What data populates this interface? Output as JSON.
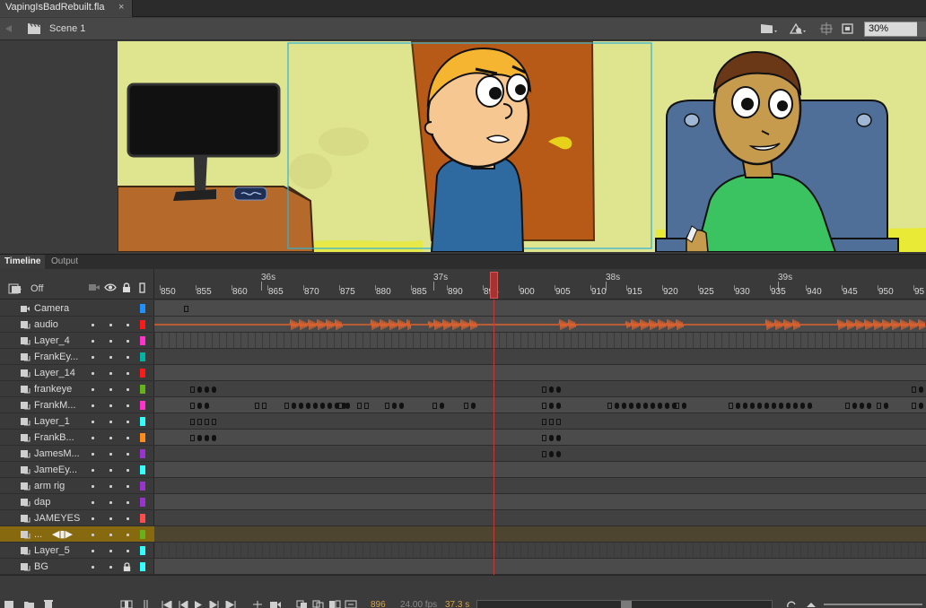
{
  "document": {
    "tab_title": "VapingIsBadRebuilt.fla",
    "close_glyph": "×"
  },
  "edit_bar": {
    "scene_label": "Scene 1",
    "zoom": "30%"
  },
  "panel_tabs": [
    {
      "label": "Timeline",
      "active": true
    },
    {
      "label": "Output",
      "active": false
    }
  ],
  "timeline": {
    "onion_label": "Off",
    "seconds": [
      "36s",
      "37s",
      "38s",
      "39s"
    ],
    "frame_ticks": [
      "850",
      "855",
      "860",
      "865",
      "870",
      "875",
      "880",
      "885",
      "890",
      "895",
      "900",
      "905",
      "910",
      "915",
      "920",
      "925",
      "930",
      "935",
      "940",
      "945",
      "950",
      "95"
    ],
    "current_frame": "896",
    "fps": "24.00 fps",
    "time": "37.3 s",
    "layers": [
      {
        "name": "Camera",
        "color": "#1e90ff",
        "type": "camera"
      },
      {
        "name": "audio",
        "color": "#ff1a1a"
      },
      {
        "name": "Layer_4",
        "color": "#ff33cc"
      },
      {
        "name": "FrankEy...",
        "color": "#00b3a4"
      },
      {
        "name": "Layer_14",
        "color": "#ff1a1a"
      },
      {
        "name": "frankeye",
        "color": "#66b219"
      },
      {
        "name": "FrankM...",
        "color": "#ff33cc"
      },
      {
        "name": "Layer_1",
        "color": "#33ffff"
      },
      {
        "name": "FrankB...",
        "color": "#ff8c1a"
      },
      {
        "name": "JamesM...",
        "color": "#9933cc"
      },
      {
        "name": "JameEy...",
        "color": "#33ffff"
      },
      {
        "name": "arm rig",
        "color": "#9933cc"
      },
      {
        "name": "dap",
        "color": "#9933cc"
      },
      {
        "name": "JAMEYES",
        "color": "#ff4d4d"
      },
      {
        "name": "...",
        "color": "#66b219",
        "selected": true
      },
      {
        "name": "Layer_5",
        "color": "#33ffff"
      },
      {
        "name": "BG",
        "color": "#33ffff",
        "locked": true
      }
    ]
  }
}
